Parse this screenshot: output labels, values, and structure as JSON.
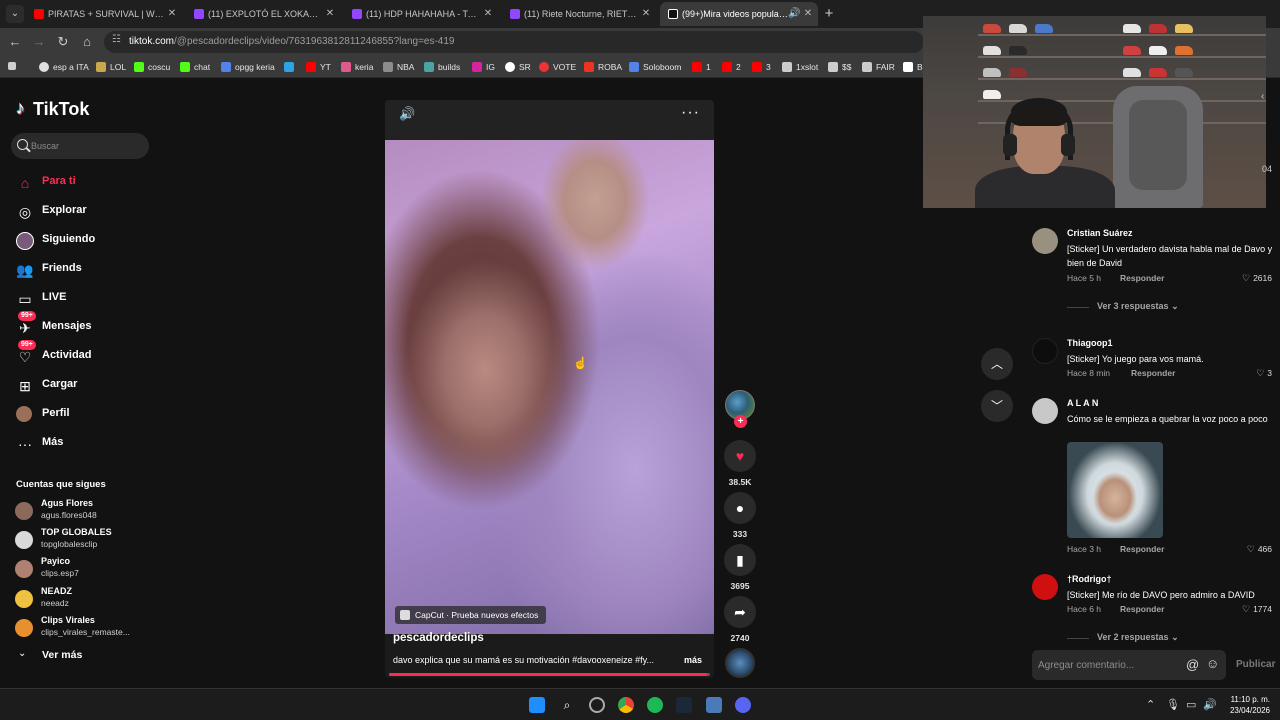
{
  "browser": {
    "tabs": [
      {
        "title": "PIRATAS + SURVIVAL | WindRo",
        "color": "#ff0000"
      },
      {
        "title": "(11) EXPLOTÓ EL XOKAS - Twitc",
        "color": "#9146ff"
      },
      {
        "title": "(11) HDP HAHAHAHA - Twitch",
        "color": "#9146ff"
      },
      {
        "title": "(11) Riete Nocturne, RIETE ! xdd",
        "color": "#9146ff"
      },
      {
        "title": "(99+)Mira videos populares",
        "color": "#ffffff"
      }
    ],
    "url_host": "tiktok.com",
    "url_path": "/@pescadordeclips/video/7631963812811246855?lang=es-419",
    "bookmarks": [
      {
        "label": "esp a ITA",
        "color": "#e0e0e0"
      },
      {
        "label": "LOL",
        "color": "#c8a84b"
      },
      {
        "label": "coscu",
        "color": "#53fc18"
      },
      {
        "label": "chat",
        "color": "#53fc18"
      },
      {
        "label": "opgg keria",
        "color": "#5383e8"
      },
      {
        "label": "",
        "color": "#2ea2e6"
      },
      {
        "label": "YT",
        "color": "#ff0000"
      },
      {
        "label": "keria",
        "color": "#e05a8c"
      },
      {
        "label": "NBA",
        "color": "#8c8c8c"
      },
      {
        "label": "builds",
        "color": "#4ba3a3"
      },
      {
        "label": "IG",
        "color": "#d6249f"
      },
      {
        "label": "SR",
        "color": "#ffffff"
      },
      {
        "label": "VOTE",
        "color": "#e33"
      },
      {
        "label": "ROBA",
        "color": "#ee3322"
      },
      {
        "label": "Soloboom",
        "color": "#5383e8"
      },
      {
        "label": "1",
        "color": "#ff0000"
      },
      {
        "label": "2",
        "color": "#ff0000"
      },
      {
        "label": "3",
        "color": "#ff0000"
      },
      {
        "label": "1xslot",
        "color": "#cccccc"
      },
      {
        "label": "$$",
        "color": "#cccccc"
      },
      {
        "label": "FAIR",
        "color": "#cccccc"
      },
      {
        "label": "B",
        "color": "#ffffff"
      }
    ]
  },
  "tiktok": {
    "logo_text": "TikTok",
    "search_placeholder": "Buscar",
    "nav": [
      {
        "label": "Para ti",
        "icon": "home-icon"
      },
      {
        "label": "Explorar",
        "icon": "compass-icon"
      },
      {
        "label": "Siguiendo",
        "icon": "following-icon"
      },
      {
        "label": "Friends",
        "icon": "friends-icon"
      },
      {
        "label": "LIVE",
        "icon": "live-icon"
      },
      {
        "label": "Mensajes",
        "icon": "messages-icon",
        "badge": "99+"
      },
      {
        "label": "Actividad",
        "icon": "activity-icon",
        "badge": "99+"
      },
      {
        "label": "Cargar",
        "icon": "upload-icon"
      },
      {
        "label": "Perfil",
        "icon": "profile-icon"
      },
      {
        "label": "Más",
        "icon": "more-icon"
      }
    ],
    "following_title": "Cuentas que sigues",
    "following": [
      {
        "name": "Agus Flores",
        "handle": "agus.flores048",
        "color": "#8c6a5a"
      },
      {
        "name": "TOP GLOBALES",
        "handle": "topglobalesclip",
        "color": "#d9d9d9"
      },
      {
        "name": "Payico",
        "handle": "clips.esp7",
        "color": "#b08070"
      },
      {
        "name": "NEADZ",
        "handle": "neeadz",
        "color": "#f0c040"
      },
      {
        "name": "Clips Virales",
        "handle": "clips_virales_remaste...",
        "color": "#e89030"
      }
    ],
    "see_more": "Ver más"
  },
  "video": {
    "capcut_label": "CapCut · Prueba nuevos efectos",
    "author": "pescadordeclips",
    "caption": "davo explica que su mamá es su motivación #davooxeneize #fy...",
    "more_label": "más",
    "progress": 0.99
  },
  "actions": {
    "likes": "38.5K",
    "comments": "333",
    "saves": "3695",
    "shares": "2740"
  },
  "comments": [
    {
      "user": "Cristian Suárez",
      "text": "[Sticker] Un verdadero davista habla mal de Davo y bien de David",
      "time": "Hace 5 h",
      "reply": "Responder",
      "likes": "2616",
      "replies": "Ver 3 respuestas",
      "color": "#9a9080"
    },
    {
      "user": "Thiagoop1",
      "text": "[Sticker] Yo juego para vos mamá.",
      "time": "Hace 8 min",
      "reply": "Responder",
      "likes": "3",
      "color": "#0d0d0d"
    },
    {
      "user": "A L A N",
      "text": "Cómo se le empieza a quebrar la voz poco a poco",
      "time": "Hace 3 h",
      "reply": "Responder",
      "likes": "466",
      "color": "#c8c8c8"
    },
    {
      "user": "†Rodrigo†",
      "text": "[Sticker] Me río de DAVO pero admiro a DAVID",
      "time": "Hace 6 h",
      "reply": "Responder",
      "likes": "1774",
      "replies": "Ver 2 respuestas",
      "color": "#d01010"
    }
  ],
  "comment_input": {
    "placeholder": "Agregar comentario...",
    "post_label": "Publicar"
  },
  "panel_partial_number": "04",
  "taskbar": {
    "time": "11:10 p. m.",
    "date": "23/04/2026"
  }
}
